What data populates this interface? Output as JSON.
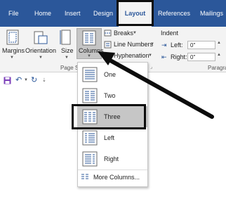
{
  "tabs": [
    {
      "label": "File"
    },
    {
      "label": "Home"
    },
    {
      "label": "Insert"
    },
    {
      "label": "Design"
    },
    {
      "label": "Layout"
    },
    {
      "label": "References"
    },
    {
      "label": "Mailings"
    }
  ],
  "ribbon": {
    "margins": "Margins",
    "orientation": "Orientation",
    "size": "Size",
    "columns": "Columns",
    "breaks": "Breaks",
    "line_numbers": "Line Numbers",
    "hyphenation": "Hyphenation",
    "indent_header": "Indent",
    "indent_left_label": "Left:",
    "indent_right_label": "Right:",
    "indent_left_value": "0\"",
    "indent_right_value": "0\"",
    "page_setup_group": "Page S",
    "paragraph_group": "Paragra"
  },
  "columns_menu": {
    "items": [
      {
        "label": "One"
      },
      {
        "label": "Two"
      },
      {
        "label": "Three"
      },
      {
        "label": "Left"
      },
      {
        "label": "Right"
      }
    ],
    "selected": "Three",
    "more": "More Columns..."
  },
  "colors": {
    "ribbon_tab_bg": "#2b579a",
    "ribbon_bg": "#f3f3f3",
    "icon_blue": "#2b579a",
    "highlight_border": "#0d0d0d"
  }
}
